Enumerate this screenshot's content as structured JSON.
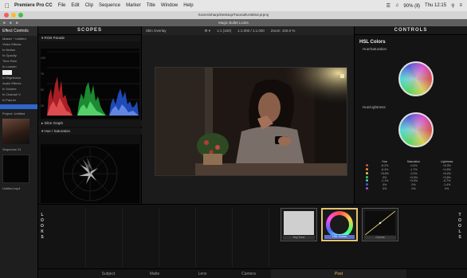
{
  "menubar": {
    "app_name": "Premiere Pro CC",
    "items": [
      "File",
      "Edit",
      "Clip",
      "Sequence",
      "Marker",
      "Title",
      "Window",
      "Help"
    ],
    "status": "90% (Ⅱ)",
    "clock": "Thu 12:15"
  },
  "window": {
    "path": "/Users/sharp/Desktop/Tutorial/Untitled.prproj",
    "panel_title": "Magic Bullet Looks"
  },
  "left_panel": {
    "header": "Effect Controls",
    "rows": [
      "Master * Untitled",
      "Video Effects",
      "fx Motion",
      "fx Opacity",
      "Time Rem",
      "fx Lumetri"
    ],
    "rows2": [
      "fx Brightness",
      "Audio Effects",
      "fx Volume",
      "fx Channel V",
      "fx Panner"
    ],
    "project_label": "Project: Untitled",
    "media_label": "Sequence 01",
    "media_label2": "Untitled.mp4"
  },
  "scopes": {
    "title": "SCOPES",
    "rgb_label": "RGB Parade",
    "slice_label": "Slice Graph",
    "hue_label": "Hue / Saturation",
    "y_ticks": [
      "100",
      "75",
      "50",
      "25",
      "0"
    ]
  },
  "viewer": {
    "mode": "Skin Overlay",
    "info": [
      "1:1 (100)",
      "1:1.000 / 1:1.000",
      "Zoom: 100.0 %"
    ]
  },
  "controls": {
    "title": "CONTROLS",
    "section": "HSL Colors",
    "wheel1": "Hue/Saturation",
    "wheel2": "Hue/Lightness",
    "table_headers": [
      "",
      "Hue",
      "Saturation",
      "Lightness"
    ],
    "rows": [
      {
        "color": "#d94848",
        "hue": "-8.2%",
        "sat": "-0.4%",
        "light": "+6.3%"
      },
      {
        "color": "#e08a3a",
        "hue": "-6.4%",
        "sat": "-1.7%",
        "light": "+4.8%"
      },
      {
        "color": "#d8d24a",
        "hue": "+8.8%",
        "sat": "-3.0%",
        "light": "+6.4%"
      },
      {
        "color": "#4ac85a",
        "hue": "0%",
        "sat": "+3.5%",
        "light": "+3.8%"
      },
      {
        "color": "#4ac8c8",
        "hue": "-1.1%",
        "sat": "+3.9%",
        "light": "-5.7%"
      },
      {
        "color": "#4a5ad8",
        "hue": "0%",
        "sat": "0%",
        "light": "-1.4%"
      },
      {
        "color": "#b04ad0",
        "hue": "0%",
        "sat": "0%",
        "light": "0%"
      }
    ]
  },
  "tools": {
    "left_label": "LOOKS",
    "right_label": "TOOLS",
    "cards": [
      {
        "label": "Key Tone"
      },
      {
        "label": "HSL Colors"
      },
      {
        "label": "Curves"
      }
    ],
    "tabs": [
      "Subject",
      "Matte",
      "Lens",
      "Camera",
      "Post"
    ],
    "active_tab": "Post"
  }
}
